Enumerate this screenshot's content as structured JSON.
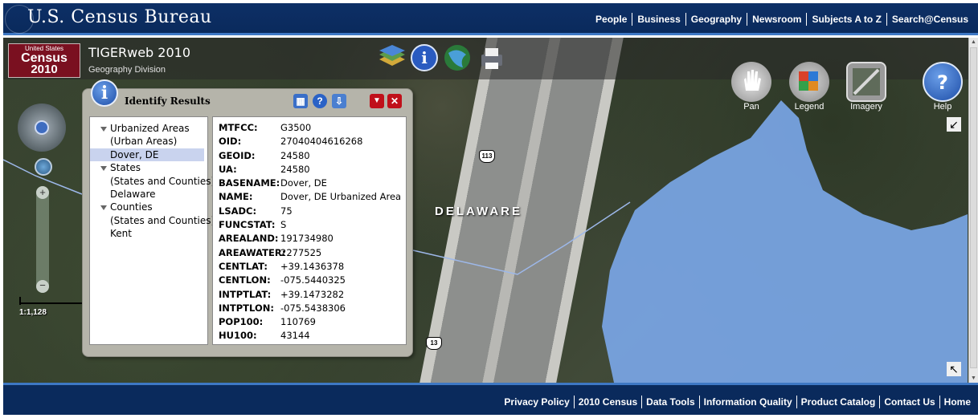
{
  "header": {
    "site_title": "U.S. Census Bureau",
    "nav": [
      "People",
      "Business",
      "Geography",
      "Newsroom",
      "Subjects A to Z",
      "Search@Census"
    ]
  },
  "app": {
    "logo_line1": "United States",
    "logo_line2": "Census",
    "logo_line3": "2010",
    "title": "TIGERweb 2010",
    "subtitle": "Geography Division"
  },
  "map_buttons": [
    {
      "label": "Pan",
      "icon": "hand-icon"
    },
    {
      "label": "Legend",
      "icon": "legend-icon"
    },
    {
      "label": "Imagery",
      "icon": "imagery-icon"
    },
    {
      "label": "Help",
      "icon": "help-icon"
    }
  ],
  "map": {
    "state_label": "DELAWARE",
    "scale": "1:1,128",
    "route_shields": [
      "113",
      "13"
    ]
  },
  "identify": {
    "title": "Identify Results",
    "tree": [
      {
        "label": "Urbanized Areas",
        "type": "group"
      },
      {
        "label": "(Urban Areas)",
        "type": "child"
      },
      {
        "label": "Dover, DE",
        "type": "child",
        "selected": true
      },
      {
        "label": "States",
        "type": "group"
      },
      {
        "label": "(States and Counties)",
        "type": "child"
      },
      {
        "label": "Delaware",
        "type": "child"
      },
      {
        "label": "Counties",
        "type": "group"
      },
      {
        "label": "(States and Counties)",
        "type": "child"
      },
      {
        "label": "Kent",
        "type": "child"
      }
    ],
    "attributes": [
      {
        "key": "MTFCC:",
        "value": "G3500"
      },
      {
        "key": "OID:",
        "value": "27040404616268"
      },
      {
        "key": "GEOID:",
        "value": "24580"
      },
      {
        "key": "UA:",
        "value": "24580"
      },
      {
        "key": "BASENAME:",
        "value": "Dover, DE"
      },
      {
        "key": "NAME:",
        "value": "Dover, DE Urbanized Area"
      },
      {
        "key": "LSADC:",
        "value": "75"
      },
      {
        "key": "FUNCSTAT:",
        "value": "S"
      },
      {
        "key": "AREALAND:",
        "value": "191734980"
      },
      {
        "key": "AREAWATER:",
        "value": "2277525"
      },
      {
        "key": "CENTLAT:",
        "value": "+39.1436378"
      },
      {
        "key": "CENTLON:",
        "value": "-075.5440325"
      },
      {
        "key": "INTPTLAT:",
        "value": "+39.1473282"
      },
      {
        "key": "INTPTLON:",
        "value": "-075.5438306"
      },
      {
        "key": "POP100:",
        "value": "110769"
      },
      {
        "key": "HU100:",
        "value": "43144"
      }
    ]
  },
  "footer": {
    "nav": [
      "Privacy Policy",
      "2010 Census",
      "Data Tools",
      "Information Quality",
      "Product Catalog",
      "Contact Us",
      "Home"
    ]
  },
  "colors": {
    "banner": "#0a2a5c",
    "banner_accent": "#3e78c4",
    "water": "#7aa6e6",
    "census_red": "#7a1020"
  }
}
